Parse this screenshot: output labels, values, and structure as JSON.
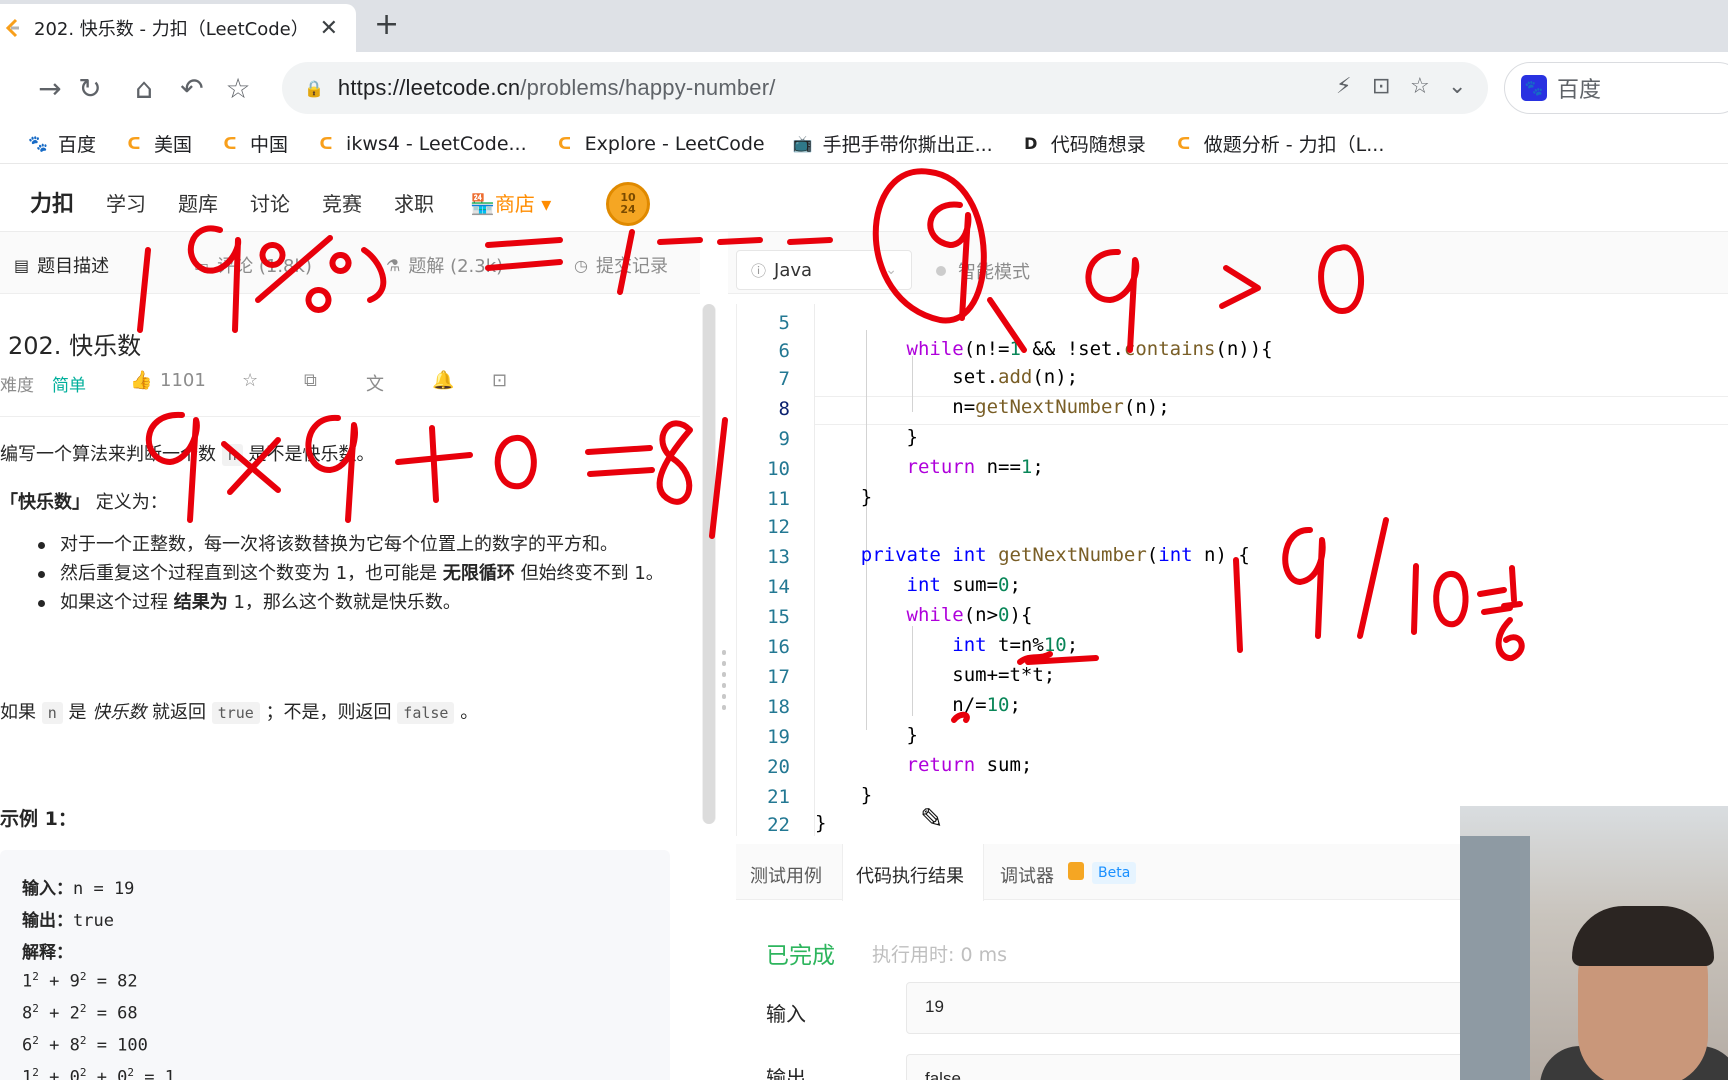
{
  "browser": {
    "tab_title": "202. 快乐数 - 力扣（LeetCode）",
    "tab_close": "✕",
    "new_tab": "+",
    "url_host": "https://leetcode.cn",
    "url_path": "/problems/happy-number/",
    "search_engine_label": "百度",
    "bookmarks": [
      "百度",
      "美国",
      "中国",
      "ikws4 - LeetCode...",
      "Explore - LeetCode",
      "手把手带你撕出正...",
      "代码随想录",
      "做题分析 - 力扣（L..."
    ]
  },
  "site_nav": {
    "logo_text": "力扣",
    "items": [
      "学习",
      "题库",
      "讨论",
      "竞赛",
      "求职"
    ],
    "shop": "商店",
    "coin_text": "10\n24"
  },
  "left_tabs": {
    "description": "题目描述",
    "comments": "评论 (1.8k)",
    "solutions": "题解 (2.3k)",
    "submissions": "提交记录"
  },
  "problem": {
    "title": "202. 快乐数",
    "difficulty_label": "难度",
    "difficulty": "简单",
    "likes": "1101",
    "intro_pre": "编写一个算法来判断一个数",
    "intro_code": "n",
    "intro_post": "是不是快乐数。",
    "def_bold": "「快乐数」",
    "def_text": "定义为：",
    "bullets": [
      {
        "pre": "对于一个正整数，每一次将该数替换为它每个位置上的数字的平方和。",
        "bold": "",
        "post": ""
      },
      {
        "pre": "然后重复这个过程直到这个数变为 1，也可能是 ",
        "bold": "无限循环",
        "post": " 但始终变不到 1。"
      },
      {
        "pre": "如果这个过程 ",
        "bold": "结果为",
        "post": " 1，那么这个数就是快乐数。"
      }
    ],
    "ret_1": "如果",
    "ret_n": "n",
    "ret_2": "是",
    "ret_happy": "快乐数",
    "ret_3": "就返回",
    "ret_true": "true",
    "ret_4": "；不是，则返回",
    "ret_false": "false",
    "ret_5": "。",
    "example_title": "示例 1：",
    "example": {
      "input_label": "输入：",
      "input": "n = 19",
      "output_label": "输出：",
      "output": "true",
      "explain_label": "解释："
    }
  },
  "editor": {
    "language": "Java",
    "smart_mode": "智能模式",
    "line_numbers": [
      "5",
      "6",
      "7",
      "8",
      "9",
      "10",
      "11",
      "12",
      "13",
      "14",
      "15",
      "16",
      "17",
      "18",
      "19",
      "20",
      "21",
      "22"
    ],
    "current_line": "8"
  },
  "console": {
    "tabs": [
      "测试用例",
      "代码执行结果",
      "调试器"
    ],
    "beta": "Beta",
    "status": "已完成",
    "runtime": "执行用时: 0 ms",
    "input_label": "输入",
    "input_value": "19",
    "output_label": "输出",
    "output_value": "false"
  }
}
